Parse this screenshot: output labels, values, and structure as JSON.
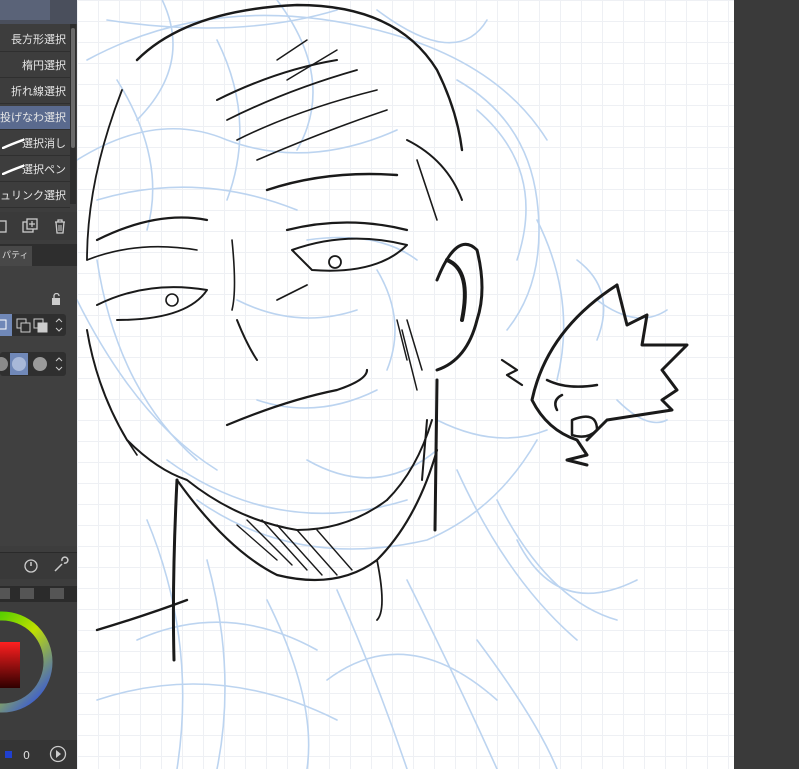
{
  "tools": {
    "items": [
      {
        "label": "長方形選択",
        "selected": false
      },
      {
        "label": "楕円選択",
        "selected": false
      },
      {
        "label": "折れ線選択",
        "selected": false
      },
      {
        "label": "投げなわ選択",
        "selected": true
      },
      {
        "label": "選択消し",
        "selected": false
      },
      {
        "label": "選択ペン",
        "selected": false
      },
      {
        "label": "ュリンク選択",
        "selected": false
      }
    ]
  },
  "property_tab": {
    "label": "パティ"
  },
  "color": {
    "value_label": "0",
    "accent": "#5a6a8e",
    "main_color": "#e0001a"
  },
  "canvas": {
    "grid_color": "#eef0f4",
    "sketch_color": "#bcd4f0",
    "ink_color": "#1a1a1a"
  }
}
